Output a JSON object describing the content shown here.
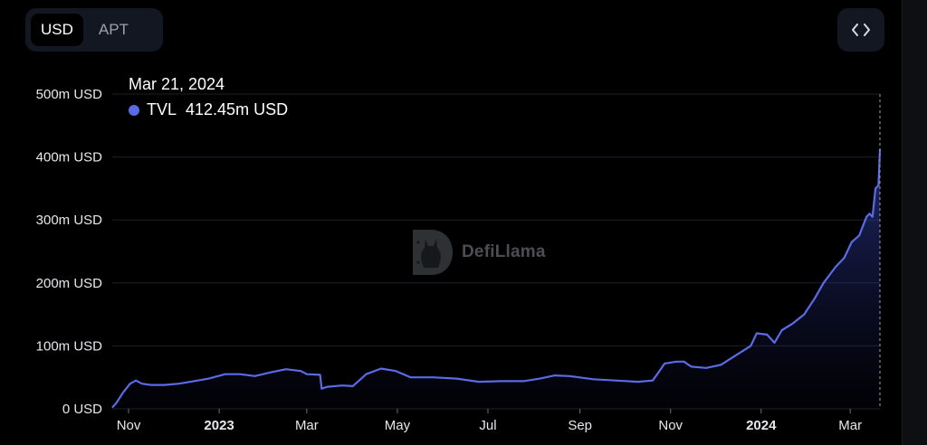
{
  "toggle": {
    "options": [
      "USD",
      "APT"
    ],
    "active": "USD"
  },
  "embed": {
    "icon": "code-brackets-icon"
  },
  "tooltip": {
    "date": "Mar 21, 2024",
    "series_name": "TVL",
    "value": "412.45m USD"
  },
  "watermark": {
    "text": "DefiLlama",
    "icon": "llama-logo-icon"
  },
  "colors": {
    "line": "#5a6be8",
    "background": "#000000",
    "grid": "#1d2027",
    "tick_text": "#e6e8ec"
  },
  "chart_data": {
    "type": "area",
    "title": "",
    "xlabel": "",
    "ylabel": "",
    "ylim": [
      0,
      500
    ],
    "y_unit": "m USD",
    "grid": "horizontal",
    "legend": "none",
    "y_ticks": [
      "0 USD",
      "100m USD",
      "200m USD",
      "300m USD",
      "400m USD",
      "500m USD"
    ],
    "y_tick_values": [
      0,
      100,
      200,
      300,
      400,
      500
    ],
    "x_range": [
      "2022-10-21",
      "2024-03-21"
    ],
    "x_ticks": [
      {
        "label": "Nov",
        "date": "2022-11-01",
        "bold": false
      },
      {
        "label": "2023",
        "date": "2023-01-01",
        "bold": true
      },
      {
        "label": "Mar",
        "date": "2023-03-01",
        "bold": false
      },
      {
        "label": "May",
        "date": "2023-05-01",
        "bold": false
      },
      {
        "label": "Jul",
        "date": "2023-07-01",
        "bold": false
      },
      {
        "label": "Sep",
        "date": "2023-09-01",
        "bold": false
      },
      {
        "label": "Nov",
        "date": "2023-11-01",
        "bold": false
      },
      {
        "label": "2024",
        "date": "2024-01-01",
        "bold": true
      },
      {
        "label": "Mar",
        "date": "2024-03-01",
        "bold": false
      }
    ],
    "series": [
      {
        "name": "TVL",
        "x": [
          "2022-10-21",
          "2022-10-24",
          "2022-10-28",
          "2022-11-02",
          "2022-11-06",
          "2022-11-10",
          "2022-11-16",
          "2022-11-25",
          "2022-12-05",
          "2022-12-15",
          "2022-12-25",
          "2023-01-05",
          "2023-01-15",
          "2023-01-25",
          "2023-02-05",
          "2023-02-15",
          "2023-02-25",
          "2023-03-01",
          "2023-03-10",
          "2023-03-11",
          "2023-03-15",
          "2023-03-25",
          "2023-04-01",
          "2023-04-10",
          "2023-04-20",
          "2023-04-30",
          "2023-05-10",
          "2023-05-25",
          "2023-06-10",
          "2023-06-25",
          "2023-07-10",
          "2023-07-25",
          "2023-08-05",
          "2023-08-15",
          "2023-08-25",
          "2023-09-10",
          "2023-09-25",
          "2023-10-10",
          "2023-10-20",
          "2023-10-23",
          "2023-10-28",
          "2023-11-05",
          "2023-11-10",
          "2023-11-15",
          "2023-11-25",
          "2023-12-05",
          "2023-12-15",
          "2023-12-25",
          "2023-12-29",
          "2024-01-05",
          "2024-01-10",
          "2024-01-15",
          "2024-01-22",
          "2024-01-30",
          "2024-02-06",
          "2024-02-12",
          "2024-02-20",
          "2024-02-26",
          "2024-03-02",
          "2024-03-07",
          "2024-03-12",
          "2024-03-14",
          "2024-03-16",
          "2024-03-18",
          "2024-03-20",
          "2024-03-21"
        ],
        "values": [
          2,
          10,
          25,
          40,
          45,
          40,
          38,
          38,
          40,
          44,
          48,
          55,
          55,
          52,
          58,
          63,
          60,
          55,
          54,
          32,
          35,
          37,
          36,
          55,
          64,
          60,
          50,
          50,
          48,
          43,
          44,
          44,
          48,
          53,
          52,
          47,
          45,
          43,
          45,
          55,
          72,
          75,
          75,
          67,
          65,
          70,
          85,
          100,
          120,
          118,
          105,
          125,
          135,
          150,
          175,
          200,
          225,
          240,
          265,
          275,
          305,
          310,
          305,
          350,
          355,
          412.45
        ]
      }
    ]
  }
}
